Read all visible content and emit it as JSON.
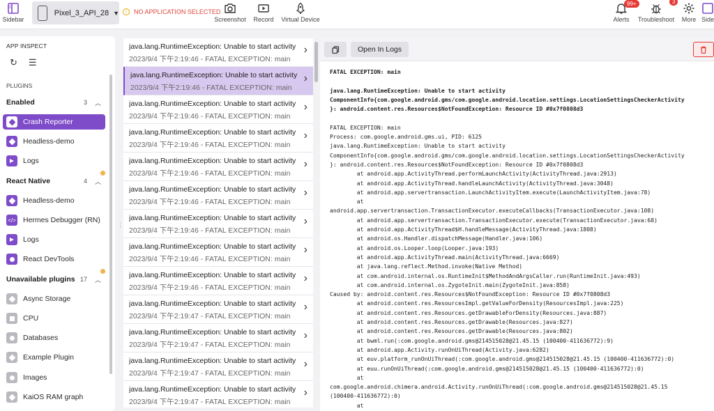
{
  "toolbar": {
    "sidebar_label": "Sidebar",
    "device_name": "Pixel_3_API_28",
    "no_app": "NO APPLICATION SELECTED",
    "screenshot_label": "Screenshot",
    "record_label": "Record",
    "virtual_device_label": "Virtual Device",
    "alerts_label": "Alerts",
    "alerts_badge": "99+",
    "troubleshoot_label": "Troubleshoot",
    "troubleshoot_badge": "3",
    "more_label": "More",
    "side_label": "Side"
  },
  "sidebar": {
    "title": "APP INSPECT",
    "plugins_heading": "PLUGINS",
    "groups": [
      {
        "name": "Enabled",
        "count": "3"
      },
      {
        "name": "React Native",
        "count": "4"
      },
      {
        "name": "Unavailable plugins",
        "count": "17"
      }
    ],
    "enabled_items": [
      "Crash Reporter",
      "Headless-demo",
      "Logs"
    ],
    "rn_items": [
      "Headless-demo",
      "Hermes Debugger (RN)",
      "Logs",
      "React DevTools"
    ],
    "unavailable_items": [
      "Async Storage",
      "CPU",
      "Databases",
      "Example Plugin",
      "Images",
      "KaiOS RAM graph"
    ]
  },
  "crashes": {
    "items": [
      {
        "title": "java.lang.RuntimeException: Unable to start activity",
        "meta": "2023/9/4 下午2:19:46 - FATAL EXCEPTION: main"
      },
      {
        "title": "java.lang.RuntimeException: Unable to start activity",
        "meta": "2023/9/4 下午2:19:46 - FATAL EXCEPTION: main"
      },
      {
        "title": "java.lang.RuntimeException: Unable to start activity",
        "meta": "2023/9/4 下午2:19:46 - FATAL EXCEPTION: main"
      },
      {
        "title": "java.lang.RuntimeException: Unable to start activity",
        "meta": "2023/9/4 下午2:19:46 - FATAL EXCEPTION: main"
      },
      {
        "title": "java.lang.RuntimeException: Unable to start activity",
        "meta": "2023/9/4 下午2:19:46 - FATAL EXCEPTION: main"
      },
      {
        "title": "java.lang.RuntimeException: Unable to start activity",
        "meta": "2023/9/4 下午2:19:46 - FATAL EXCEPTION: main"
      },
      {
        "title": "java.lang.RuntimeException: Unable to start activity",
        "meta": "2023/9/4 下午2:19:46 - FATAL EXCEPTION: main"
      },
      {
        "title": "java.lang.RuntimeException: Unable to start activity",
        "meta": "2023/9/4 下午2:19:46 - FATAL EXCEPTION: main"
      },
      {
        "title": "java.lang.RuntimeException: Unable to start activity",
        "meta": "2023/9/4 下午2:19:46 - FATAL EXCEPTION: main"
      },
      {
        "title": "java.lang.RuntimeException: Unable to start activity",
        "meta": "2023/9/4 下午2:19:47 - FATAL EXCEPTION: main"
      },
      {
        "title": "java.lang.RuntimeException: Unable to start activity",
        "meta": "2023/9/4 下午2:19:47 - FATAL EXCEPTION: main"
      },
      {
        "title": "java.lang.RuntimeException: Unable to start activity",
        "meta": "2023/9/4 下午2:19:47 - FATAL EXCEPTION: main"
      },
      {
        "title": "java.lang.RuntimeException: Unable to start activity",
        "meta": "2023/9/4 下午2:19:47 - FATAL EXCEPTION: main"
      }
    ],
    "selected_index": 1
  },
  "detail": {
    "open_in_logs": "Open In Logs",
    "header": "FATAL EXCEPTION: main",
    "reason": "java.lang.RuntimeException: Unable to start activity\nComponentInfo{com.google.android.gms/com.google.android.location.settings.LocationSettingsCheckerActivity\n}: android.content.res.Resources$NotFoundException: Resource ID #0x7f0808d3",
    "stacktrace": "FATAL EXCEPTION: main\nProcess: com.google.android.gms.ui, PID: 6125\njava.lang.RuntimeException: Unable to start activity\nComponentInfo{com.google.android.gms/com.google.android.location.settings.LocationSettingsCheckerActivity\n}: android.content.res.Resources$NotFoundException: Resource ID #0x7f0808d3\n        at android.app.ActivityThread.performLaunchActivity(ActivityThread.java:2913)\n        at android.app.ActivityThread.handleLaunchActivity(ActivityThread.java:3048)\n        at android.app.servertransaction.LaunchActivityItem.execute(LaunchActivityItem.java:78)\n        at\nandroid.app.servertransaction.TransactionExecutor.executeCallbacks(TransactionExecutor.java:108)\n        at android.app.servertransaction.TransactionExecutor.execute(TransactionExecutor.java:68)\n        at android.app.ActivityThread$H.handleMessage(ActivityThread.java:1808)\n        at android.os.Handler.dispatchMessage(Handler.java:106)\n        at android.os.Looper.loop(Looper.java:193)\n        at android.app.ActivityThread.main(ActivityThread.java:6669)\n        at java.lang.reflect.Method.invoke(Native Method)\n        at com.android.internal.os.RuntimeInit$MethodAndArgsCaller.run(RuntimeInit.java:493)\n        at com.android.internal.os.ZygoteInit.main(ZygoteInit.java:858)\nCaused by: android.content.res.Resources$NotFoundException: Resource ID #0x7f0808d3\n        at android.content.res.ResourcesImpl.getValueForDensity(ResourcesImpl.java:225)\n        at android.content.res.Resources.getDrawableForDensity(Resources.java:887)\n        at android.content.res.Resources.getDrawable(Resources.java:827)\n        at android.content.res.Resources.getDrawable(Resources.java:802)\n        at bwml.run(:com.google.android.gms@214515028@21.45.15 (100400-411636772):9)\n        at android.app.Activity.runOnUiThread(Activity.java:6282)\n        at euv.platform_runOnUiThread(:com.google.android.gms@214515028@21.45.15 (100400-411636772):0)\n        at euu.runOnUiThread(:com.google.android.gms@214515028@21.45.15 (100400-411636772):0)\n        at\ncom.google.android.chimera.android.Activity.runOnUiThread(:com.google.android.gms@214515028@21.45.15\n(100400-411636772):0)\n        at"
  },
  "icons": {
    "sidebar": "sidebar-icon",
    "device": "phone-icon",
    "screenshot": "camera-icon",
    "record": "video-icon",
    "virtual_device": "rocket-icon",
    "alerts": "bell-icon",
    "troubleshoot": "bug-icon",
    "more": "gear-icon",
    "refresh": "refresh-icon",
    "menu": "menu-icon",
    "copy": "copy-icon",
    "delete": "trash-icon"
  },
  "colors": {
    "accent": "#7e4bc9",
    "selected_row": "#d7c8ef",
    "danger": "#e53935",
    "warning": "#e8a500"
  }
}
